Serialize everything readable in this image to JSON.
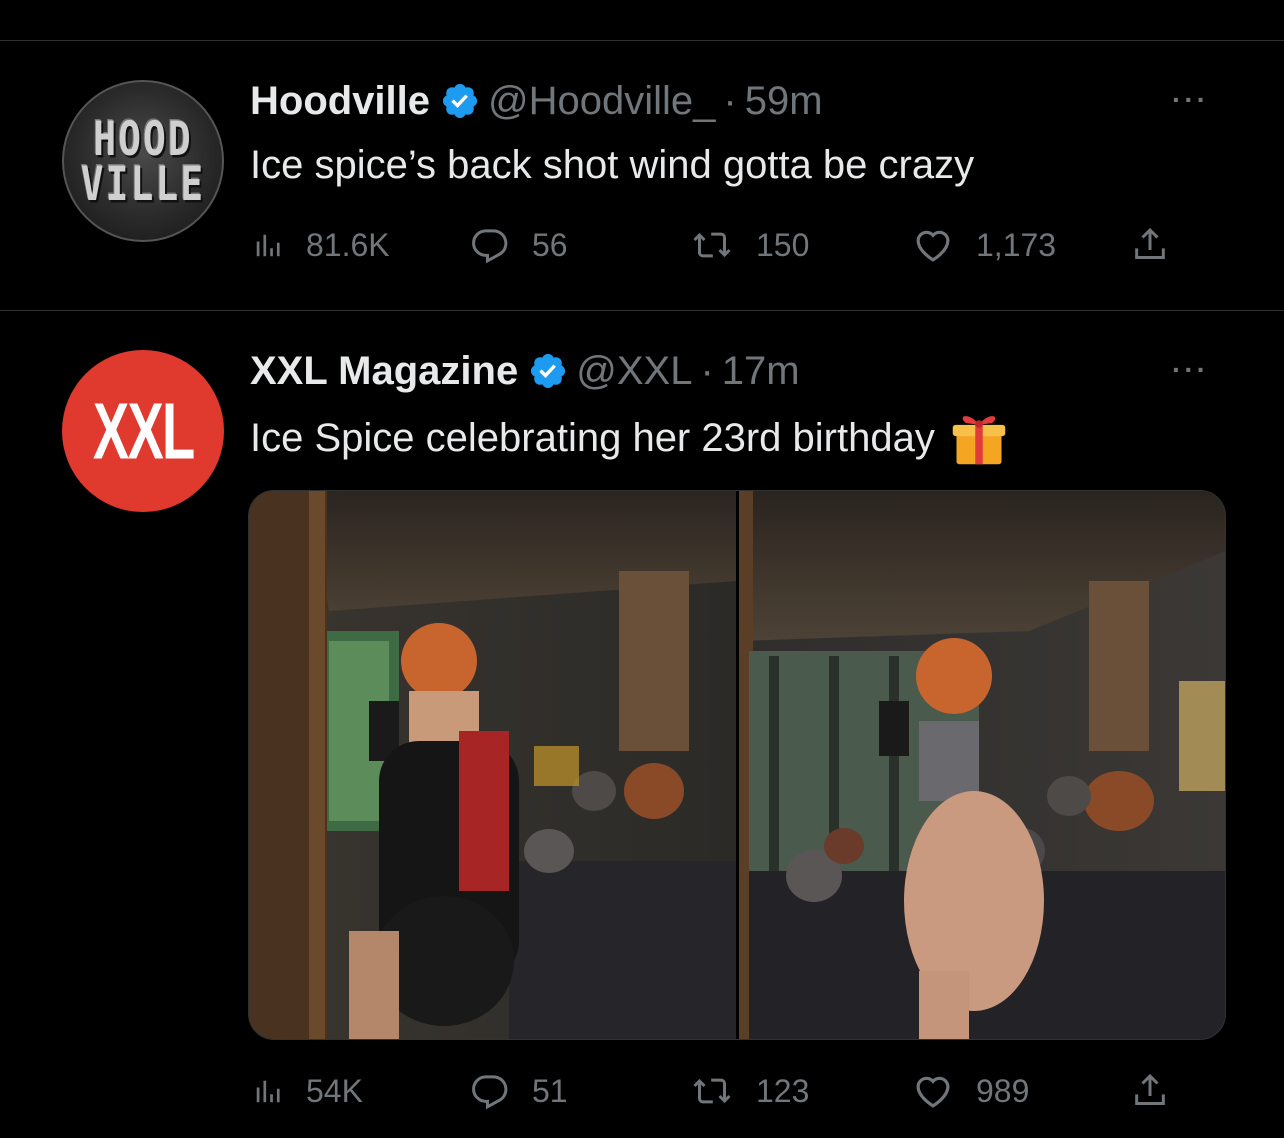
{
  "tweets": [
    {
      "author": "Hoodville",
      "handle": "@Hoodville_",
      "separator": "·",
      "time": "59m",
      "text": "Ice spice’s back shot wind gotta be crazy",
      "avatar_text_line1": "HOOD",
      "avatar_text_line2": "VILLE",
      "stats": {
        "views": "81.6K",
        "replies": "56",
        "retweets": "150",
        "likes": "1,173"
      }
    },
    {
      "author": "XXL Magazine",
      "handle": "@XXL",
      "separator": "·",
      "time": "17m",
      "text": "Ice Spice celebrating her 23rd birthday",
      "avatar_text": "XXL",
      "emoji": "gift-icon",
      "stats": {
        "views": "54K",
        "replies": "51",
        "retweets": "123",
        "likes": "989"
      }
    }
  ],
  "more_label": "···",
  "colors": {
    "background": "#000000",
    "text": "#e7e9ea",
    "muted": "#71767b",
    "verified": "#1d9bf0",
    "xxl_red": "#e03a2f",
    "divider": "#2f3336"
  }
}
